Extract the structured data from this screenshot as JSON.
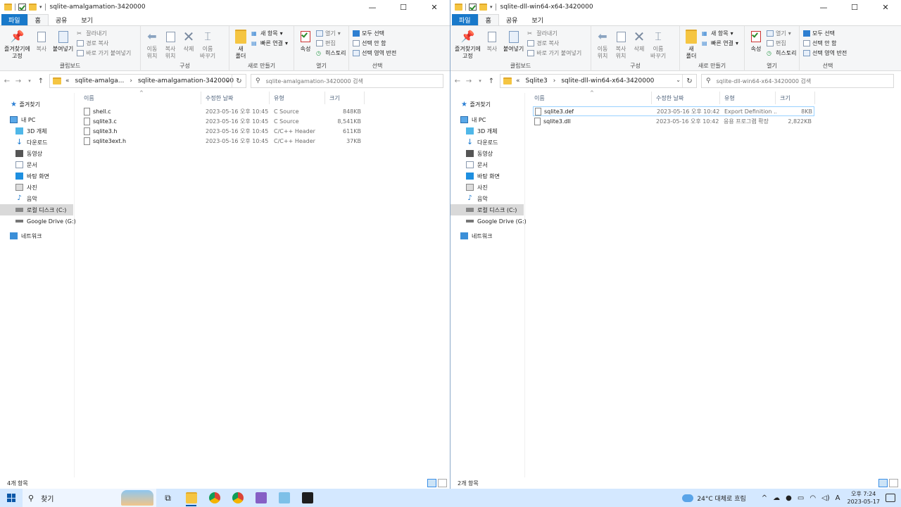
{
  "left": {
    "title": "sqlite-amalgamation-3420000",
    "tabs": [
      "파일",
      "홈",
      "공유",
      "보기"
    ],
    "ribbon": {
      "pin_quick": "즐겨찾기에\n고정",
      "copy": "복사",
      "paste": "붙여넣기",
      "cut": "잘라내기",
      "copy_path": "경로 복사",
      "paste_shortcut": "바로 가기 붙여넣기",
      "clipboard": "클립보드",
      "move_to": "이동\n위치",
      "copy_to": "복사\n위치",
      "delete": "삭제",
      "rename": "이름\n바꾸기",
      "organize": "구성",
      "new_folder": "새\n폴더",
      "new_item": "새 항목",
      "easy_access": "빠른 연결",
      "new": "새로 만들기",
      "properties": "속성",
      "open": "열기",
      "edit": "편집",
      "history": "히스토리",
      "open_group": "열기",
      "select_all": "모두 선택",
      "select_none": "선택 안 함",
      "invert_selection": "선택 영역 반전",
      "select_group": "선택"
    },
    "breadcrumb": [
      "sqlite-amalga...",
      "sqlite-amalgamation-3420000"
    ],
    "search_placeholder": "sqlite-amalgamation-3420000 검색",
    "columns": [
      "이름",
      "수정한 날짜",
      "유형",
      "크기"
    ],
    "files": [
      {
        "name": "shell.c",
        "date": "2023-05-16 오후 10:45",
        "type": "C Source",
        "size": "848KB"
      },
      {
        "name": "sqlite3.c",
        "date": "2023-05-16 오후 10:45",
        "type": "C Source",
        "size": "8,541KB"
      },
      {
        "name": "sqlite3.h",
        "date": "2023-05-16 오후 10:45",
        "type": "C/C++ Header",
        "size": "611KB"
      },
      {
        "name": "sqlite3ext.h",
        "date": "2023-05-16 오후 10:45",
        "type": "C/C++ Header",
        "size": "37KB"
      }
    ],
    "status": "4개 항목"
  },
  "right": {
    "title": "sqlite-dll-win64-x64-3420000",
    "breadcrumb": [
      "Sqlite3",
      "sqlite-dll-win64-x64-3420000"
    ],
    "search_placeholder": "sqlite-dll-win64-x64-3420000 검색",
    "files": [
      {
        "name": "sqlite3.def",
        "date": "2023-05-16 오후 10:42",
        "type": "Export Definition ...",
        "size": "8KB"
      },
      {
        "name": "sqlite3.dll",
        "date": "2023-05-16 오후 10:42",
        "type": "응용 프로그램 확장",
        "size": "2,822KB"
      }
    ],
    "status": "2개 항목"
  },
  "nav": [
    "즐겨찾기",
    "내 PC",
    "3D 개체",
    "다운로드",
    "동영상",
    "문서",
    "바탕 화면",
    "사진",
    "음악",
    "로컬 디스크 (C:)",
    "Google Drive (G:)",
    "네트워크"
  ],
  "taskbar": {
    "search": "찾기",
    "weather": "24°C  대체로 흐림",
    "time": "오후 7:24",
    "date": "2023-05-17",
    "ime": "A"
  }
}
